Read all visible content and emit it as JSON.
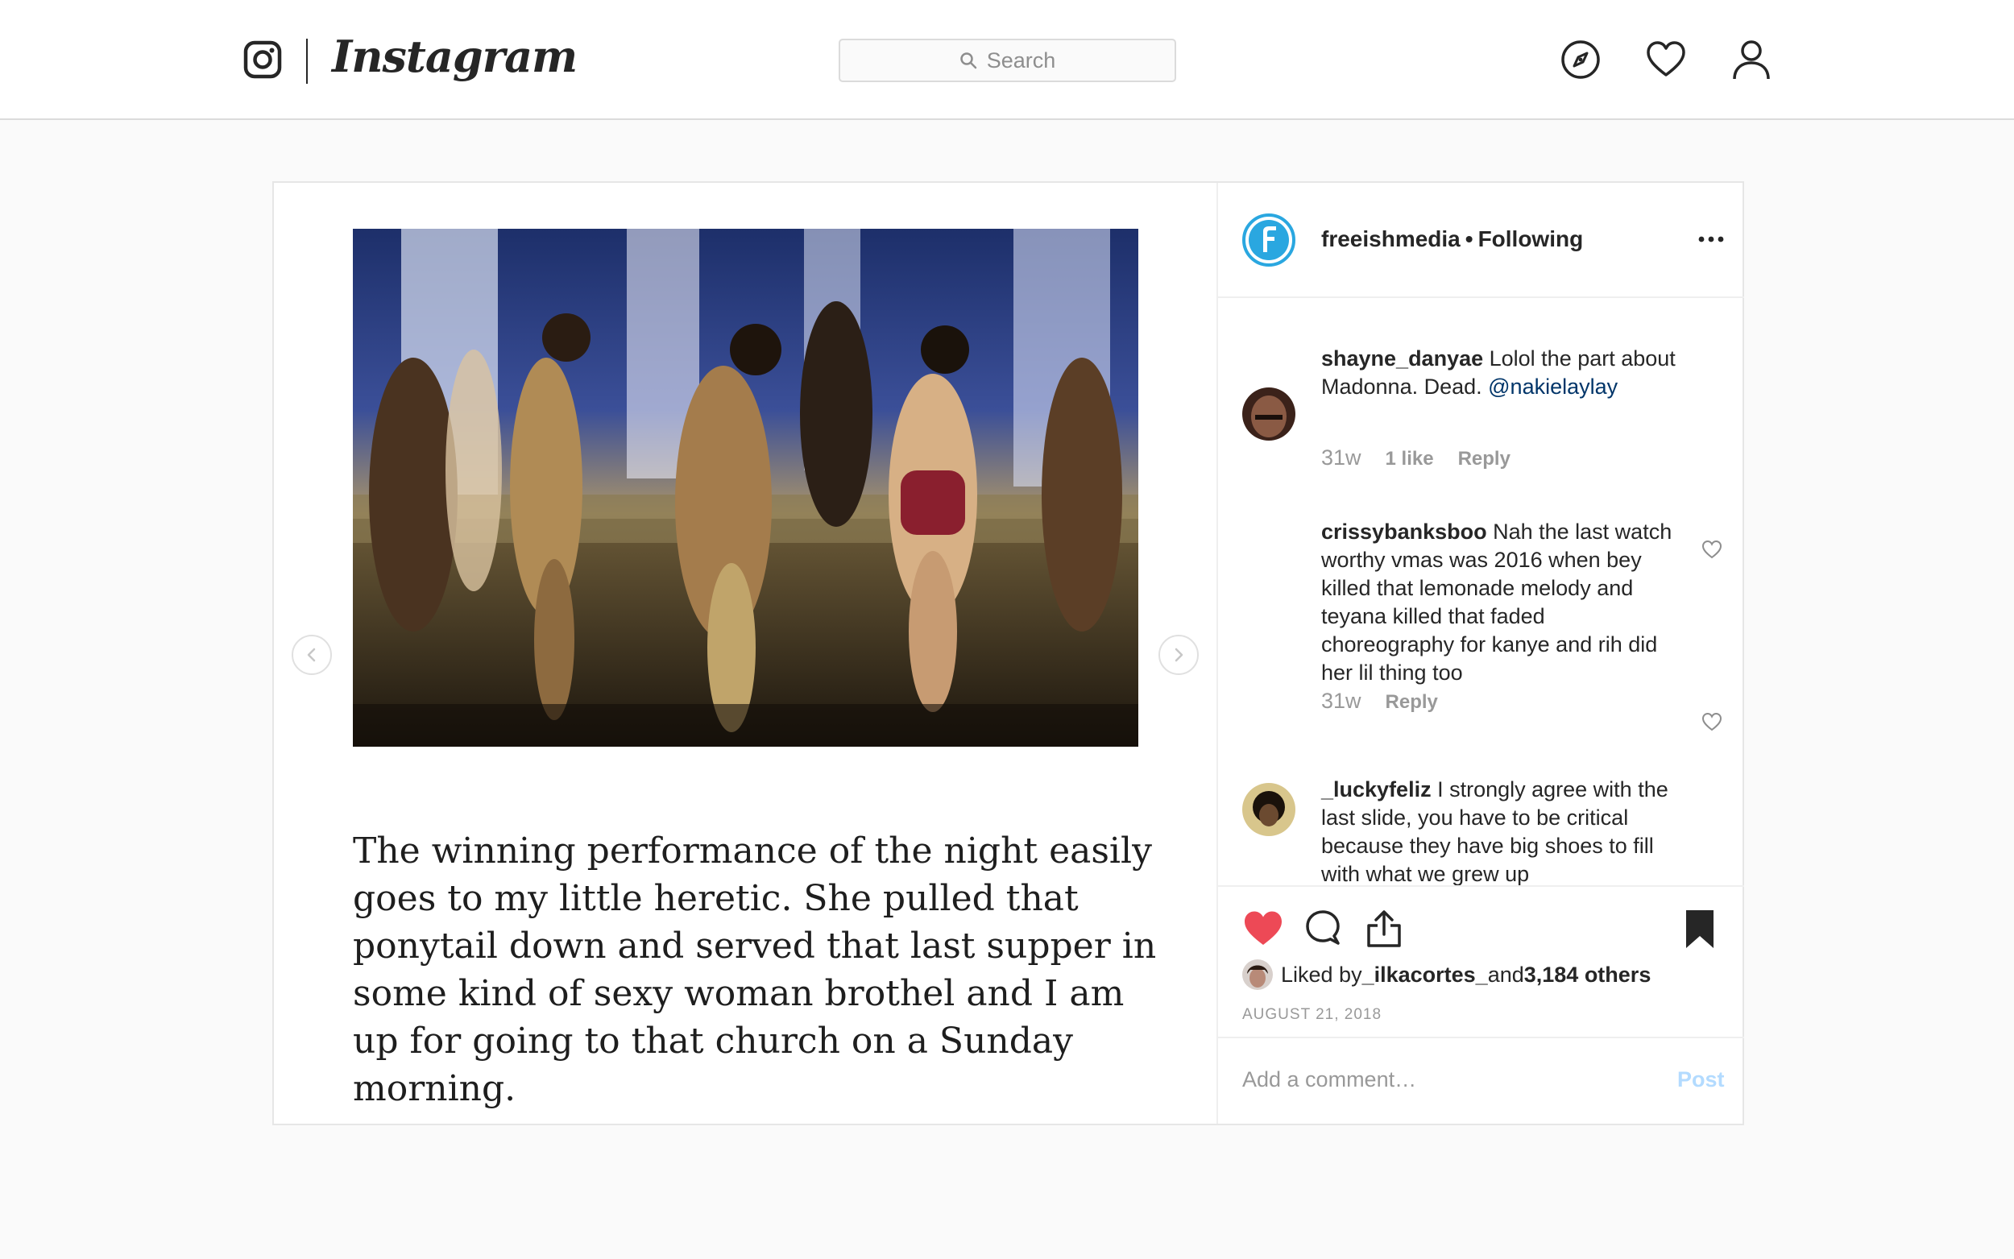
{
  "nav": {
    "logo_text": "Instagram",
    "search_placeholder": "Search",
    "icons": [
      "instagram-glyph-icon",
      "search-icon",
      "compass-icon",
      "heart-icon",
      "profile-icon"
    ]
  },
  "post": {
    "image_caption": "The winning performance of the night easily goes to my little heretic. She pulled that ponytail down and served that last supper in some kind of sexy woman brothel and I am up for going to that church on a Sunday morning.",
    "author": "freeishmedia",
    "follow_status": "Following",
    "comments": [
      {
        "user": "shayne_danyae",
        "text": " Lolol the part about Madonna. Dead. ",
        "mention": "@nakielaylay",
        "age": "31w",
        "likes": "1 like",
        "reply": "Reply"
      },
      {
        "user": "crissybanksboo",
        "text": " Nah the last watch worthy vmas was 2016 when bey killed that lemonade melody and teyana killed that faded choreography for kanye and rih did her lil thing too",
        "mention": "",
        "age": "31w",
        "likes": "",
        "reply": "Reply"
      },
      {
        "user": "_luckyfeliz",
        "text": " I strongly agree with the last slide, you have to be critical because they have big shoes to fill with what we grew up",
        "mention": "",
        "age": "",
        "likes": "",
        "reply": ""
      }
    ],
    "liked_prefix": "Liked by ",
    "liked_user": "_ilkacortes_",
    "liked_mid": " and ",
    "liked_count": "3,184 others",
    "date": "AUGUST 21, 2018",
    "add_comment_placeholder": "Add a comment…",
    "post_button": "Post"
  },
  "colors": {
    "like_red": "#ed4956",
    "brand_blue": "#2aa7e0",
    "link_blue": "#003569"
  }
}
